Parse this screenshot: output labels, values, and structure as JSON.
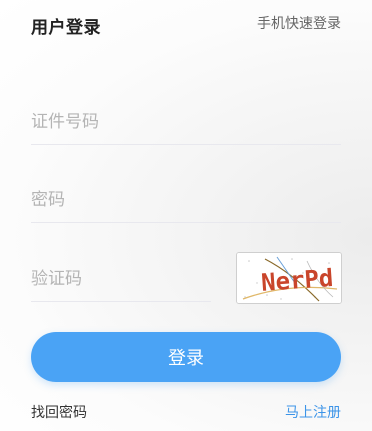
{
  "header": {
    "title": "用户登录",
    "switch_link": "手机快速登录"
  },
  "form": {
    "id_number": {
      "placeholder": "证件号码",
      "value": ""
    },
    "password": {
      "placeholder": "密码",
      "value": ""
    },
    "captcha": {
      "placeholder": "验证码",
      "value": ""
    },
    "captcha_image_text": "NerPd",
    "login_button": "登录"
  },
  "footer": {
    "forgot_password": "找回密码",
    "register": "马上注册"
  },
  "colors": {
    "primary": "#4aa3f5",
    "link": "#3c94e8"
  }
}
